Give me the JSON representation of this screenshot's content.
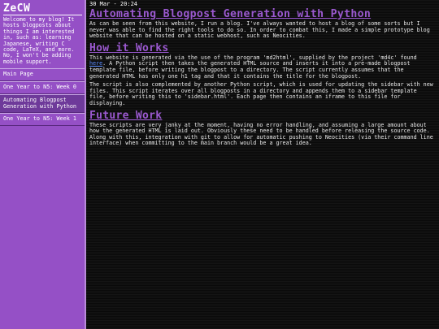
{
  "sidebar": {
    "brand": "ZeCW",
    "about": "Welcome to my blog! It hosts blogposts about things I am interested in, such as: learning Japanese, writing C code, LaTeX, and more. No, I won't be adding mobile support.",
    "items": [
      {
        "label": "Main Page"
      },
      {
        "label": "One Year to N5: Week 0"
      },
      {
        "label": "Automating Blogpost Generation with Python"
      },
      {
        "label": "One Year to N5: Week 1"
      }
    ]
  },
  "post": {
    "date": "30 Mar - 20:24",
    "title": "Automating Blogpost Generation with Python",
    "intro": "As can be seen from this website, I run a blog. I've always wanted to host a blog of some sorts but I never was able to find the right tools to do so. In order to combat this, I made a simple prototype blog website that can be hosted on a static webhost, such as Neocities.",
    "how_heading": "How it Works",
    "how_p1_before": "This website is generated via the use of the program 'md2html', supplied by the project 'md4c' found ",
    "how_p1_link": "here",
    "how_p1_after": ". A Python script then takes the generated HTML source and inserts it into a pre-made blogpost template file, before writing the blogpost to a directory. The script currently assumes that the generated HTML has only one h1 tag and that it contains the title for the blogpost.",
    "how_p2": "The script is also complemented by another Python script, which is used for updating the sidebar with new files. This script iterates over all blogposts in a directory and appends them to a sidebar template file, before writing this to 'sidebar.html'. Each page then contains an iframe to this file for displaying.",
    "future_heading": "Future Work",
    "future_p": "These scripts are very janky at the moment, having no error handling, and assuming a large amount about how the generated HTML is laid out. Obviously these need to be handled before releasing the source code. Along with this, integration with git to allow for automatic pushing to Neocities (via their command line interface) when committing to the main branch would be a great idea."
  },
  "colors": {
    "sidebar_bg": "#9550c6",
    "heading": "#9b59d0",
    "link": "#5a8cff",
    "content_bg": "#0d0d0d"
  }
}
